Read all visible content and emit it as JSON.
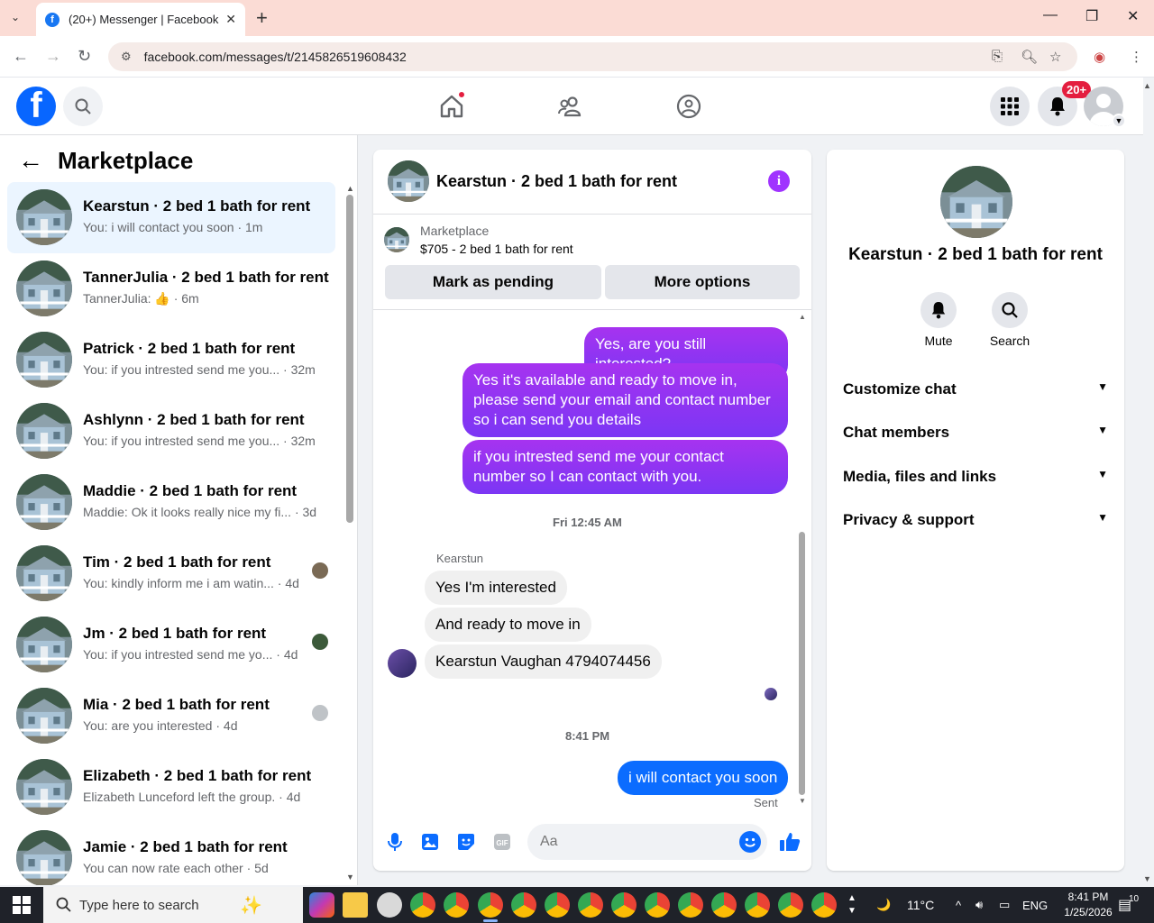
{
  "browser": {
    "tab_title": "(20+) Messenger | Facebook",
    "tab_close": "✕",
    "new_tab": "+",
    "tab_search": "⌄",
    "url": "facebook.com/messages/t/2145826519608432",
    "back": "←",
    "forward": "→",
    "reload": "↻",
    "minimize": "—",
    "restore": "❐",
    "close": "✕"
  },
  "fb": {
    "logo": "f",
    "notification_badge": "20+"
  },
  "sidebar": {
    "back": "←",
    "title": "Marketplace",
    "conversations": [
      {
        "name": "Kearstun · 2 bed 1 bath for rent",
        "preview": "You: i will contact you soon · 1m",
        "active": true
      },
      {
        "name": "TannerJulia · 2 bed 1 bath for rent",
        "preview": "TannerJulia: 👍 · 6m"
      },
      {
        "name": "Patrick · 2 bed 1 bath for rent",
        "preview": "You: if you intrested send me you... · 32m"
      },
      {
        "name": "Ashlynn · 2 bed 1 bath for rent",
        "preview": "You: if you intrested send me you... · 32m"
      },
      {
        "name": "Maddie · 2 bed 1 bath for rent",
        "preview": "Maddie: Ok it looks really nice my fi... · 3d"
      },
      {
        "name": "Tim · 2 bed 1 bath for rent",
        "preview": "You: kindly inform me i am watin... · 4d"
      },
      {
        "name": "Jm · 2 bed 1 bath for rent",
        "preview": "You: if you intrested send me yo... · 4d"
      },
      {
        "name": "Mia · 2 bed 1 bath for rent",
        "preview": "You: are you interested · 4d"
      },
      {
        "name": "Elizabeth · 2 bed 1 bath for rent",
        "preview": "Elizabeth Lunceford left the group. · 4d"
      },
      {
        "name": "Jamie · 2 bed 1 bath for rent",
        "preview": "You can now rate each other · 5d"
      }
    ]
  },
  "chat": {
    "title": "Kearstun · 2 bed 1 bath for rent",
    "info": "i",
    "marketplace_label": "Marketplace",
    "listing": "$705 - 2 bed 1 bath for rent",
    "mark_pending": "Mark as pending",
    "more_options": "More options",
    "messages": {
      "m1": "Yes, are you still interested?",
      "m2": "Yes it's available and ready to move in, please send your email and contact number so i can send you details",
      "m3": "if you intrested send me your contact number so I can contact with you.",
      "time1": "Fri 12:45 AM",
      "sender": "Kearstun",
      "m4": "Yes I'm interested",
      "m5": "And ready to move in",
      "m6": "Kearstun Vaughan 4794074456",
      "time2": "8:41 PM",
      "m7": "i will contact you soon",
      "sent": "Sent"
    },
    "input_placeholder": "Aa"
  },
  "info_panel": {
    "name": "Kearstun · 2 bed 1 bath for rent",
    "mute": "Mute",
    "search": "Search",
    "sections": [
      "Customize chat",
      "Chat members",
      "Media, files and links",
      "Privacy & support"
    ]
  },
  "taskbar": {
    "search_placeholder": "Type here to search",
    "weather": "11°C",
    "lang": "ENG",
    "time": "8:41 PM",
    "date": "1/25/2026",
    "notif_count": "10"
  }
}
